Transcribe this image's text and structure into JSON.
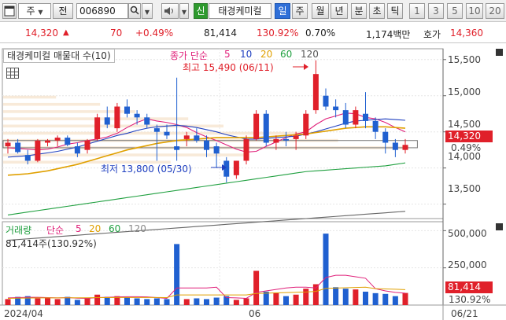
{
  "toolbar": {
    "code_label": "주",
    "prev_label": "전",
    "stock_code": "006890",
    "new_badge": "신",
    "stock_name": "태경케미컬",
    "periods": [
      "일",
      "주",
      "월",
      "년",
      "분",
      "초",
      "틱"
    ],
    "active_period": "일",
    "intervals": [
      "1",
      "3",
      "5",
      "10",
      "20"
    ]
  },
  "quote": {
    "price": "14,320",
    "change": "70",
    "change_pct": "+0.49%",
    "volume": "81,414",
    "volume_ratio": "130.92%",
    "turnover": "0.70%",
    "amount": "1,174백만",
    "ask_label": "호가",
    "ask_price": "14,360"
  },
  "legend": {
    "title": "태경케미컬 매물대 수(10)",
    "ma_label": "종가 단순",
    "ma_periods": [
      "5",
      "10",
      "20",
      "60",
      "120"
    ],
    "ma_colors": [
      "#e0207a",
      "#2040c0",
      "#e0a000",
      "#20a040",
      "#555555"
    ]
  },
  "annotations": {
    "high": "최고 15,490 (06/11)",
    "low": "최저 13,800 (05/30)"
  },
  "price_axis": [
    "15,500",
    "15,000",
    "14,500",
    "14,000",
    "13,500"
  ],
  "price_tag": {
    "value": "14,320",
    "pct": "0.49%"
  },
  "volume_legend": {
    "title": "거래량",
    "ma_label": "단순",
    "ma_periods": [
      "5",
      "20",
      "60",
      "120"
    ],
    "summary": "81,414주(130.92%)"
  },
  "volume_axis": [
    "500,000",
    "250,000"
  ],
  "volume_tag": {
    "value": "81,414",
    "pct": "130.92%"
  },
  "time_axis": {
    "start": "2024/04",
    "mid": "06",
    "end": "06/21"
  },
  "colors": {
    "up": "#e0202a",
    "down": "#2060d0",
    "accent": "#2f6fd8"
  },
  "chart_data": [
    {
      "type": "candlestick",
      "title": "태경케미컬 매물대 수(10)",
      "ylim": [
        13300,
        15650
      ],
      "y_ticks": [
        13500,
        14000,
        14500,
        15000,
        15500
      ],
      "candles": [
        {
          "o": 14300,
          "h": 14400,
          "l": 14200,
          "c": 14350
        },
        {
          "o": 14350,
          "h": 14400,
          "l": 14200,
          "c": 14220
        },
        {
          "o": 14180,
          "h": 14250,
          "l": 14050,
          "c": 14100
        },
        {
          "o": 14100,
          "h": 14400,
          "l": 14080,
          "c": 14380
        },
        {
          "o": 14350,
          "h": 14400,
          "l": 14300,
          "c": 14380
        },
        {
          "o": 14380,
          "h": 14450,
          "l": 14300,
          "c": 14420
        },
        {
          "o": 14420,
          "h": 14450,
          "l": 14300,
          "c": 14320
        },
        {
          "o": 14300,
          "h": 14350,
          "l": 14150,
          "c": 14200
        },
        {
          "o": 14250,
          "h": 14400,
          "l": 14200,
          "c": 14380
        },
        {
          "o": 14400,
          "h": 14750,
          "l": 14380,
          "c": 14700
        },
        {
          "o": 14700,
          "h": 14850,
          "l": 14550,
          "c": 14600
        },
        {
          "o": 14550,
          "h": 14900,
          "l": 14500,
          "c": 14850
        },
        {
          "o": 14850,
          "h": 14950,
          "l": 14700,
          "c": 14750
        },
        {
          "o": 14750,
          "h": 14800,
          "l": 14600,
          "c": 14700
        },
        {
          "o": 14700,
          "h": 14750,
          "l": 14550,
          "c": 14600
        },
        {
          "o": 14550,
          "h": 14600,
          "l": 14100,
          "c": 14500
        },
        {
          "o": 14500,
          "h": 14600,
          "l": 14400,
          "c": 14450
        },
        {
          "o": 14300,
          "h": 15250,
          "l": 14100,
          "c": 14250
        },
        {
          "o": 14400,
          "h": 14500,
          "l": 14300,
          "c": 14450
        },
        {
          "o": 14450,
          "h": 14550,
          "l": 14350,
          "c": 14380
        },
        {
          "o": 14380,
          "h": 14450,
          "l": 14150,
          "c": 14250
        },
        {
          "o": 14300,
          "h": 14350,
          "l": 14000,
          "c": 14200
        },
        {
          "o": 14100,
          "h": 14150,
          "l": 13800,
          "c": 13880
        },
        {
          "o": 13900,
          "h": 14100,
          "l": 13850,
          "c": 14100
        },
        {
          "o": 14100,
          "h": 14450,
          "l": 14050,
          "c": 14400
        },
        {
          "o": 14400,
          "h": 14800,
          "l": 14380,
          "c": 14750
        },
        {
          "o": 14750,
          "h": 14800,
          "l": 14300,
          "c": 14350
        },
        {
          "o": 14350,
          "h": 14450,
          "l": 14250,
          "c": 14400
        },
        {
          "o": 14400,
          "h": 14500,
          "l": 14300,
          "c": 14380
        },
        {
          "o": 14400,
          "h": 14500,
          "l": 14250,
          "c": 14450
        },
        {
          "o": 14450,
          "h": 14800,
          "l": 14400,
          "c": 14750
        },
        {
          "o": 14800,
          "h": 15490,
          "l": 14750,
          "c": 15300
        },
        {
          "o": 15000,
          "h": 15100,
          "l": 14800,
          "c": 14850
        },
        {
          "o": 14850,
          "h": 14950,
          "l": 14700,
          "c": 14800
        },
        {
          "o": 14800,
          "h": 14900,
          "l": 14550,
          "c": 14600
        },
        {
          "o": 14600,
          "h": 14850,
          "l": 14550,
          "c": 14800
        },
        {
          "o": 14750,
          "h": 15050,
          "l": 14550,
          "c": 14650
        },
        {
          "o": 14650,
          "h": 14700,
          "l": 14400,
          "c": 14500
        },
        {
          "o": 14500,
          "h": 14550,
          "l": 14200,
          "c": 14350
        },
        {
          "o": 14350,
          "h": 14400,
          "l": 14150,
          "c": 14250
        },
        {
          "o": 14250,
          "h": 14400,
          "l": 14200,
          "c": 14320
        }
      ],
      "ma": {
        "5": [
          14280,
          14270,
          14260,
          14250,
          14260,
          14290,
          14330,
          14350,
          14380,
          14400,
          14430,
          14480,
          14560,
          14630,
          14680,
          14650,
          14630,
          14600,
          14560,
          14490,
          14430,
          14380,
          14320,
          14260,
          14220,
          14230,
          14300,
          14360,
          14420,
          14470,
          14500,
          14600,
          14680,
          14720,
          14760,
          14750,
          14700,
          14680,
          14630,
          14560,
          14500
        ],
        "10": [
          14150,
          14160,
          14170,
          14190,
          14210,
          14230,
          14260,
          14290,
          14330,
          14370,
          14410,
          14450,
          14480,
          14520,
          14550,
          14570,
          14580,
          14590,
          14580,
          14560,
          14530,
          14500,
          14460,
          14430,
          14400,
          14400,
          14410,
          14420,
          14430,
          14440,
          14470,
          14500,
          14540,
          14580,
          14620,
          14650,
          14660,
          14670,
          14680,
          14670,
          14660
        ],
        "20": [
          13900,
          13910,
          13920,
          13940,
          13960,
          13990,
          14020,
          14050,
          14090,
          14130,
          14170,
          14210,
          14250,
          14280,
          14310,
          14340,
          14360,
          14380,
          14390,
          14400,
          14410,
          14420,
          14420,
          14420,
          14420,
          14420,
          14430,
          14440,
          14450,
          14460,
          14470,
          14490,
          14510,
          14530,
          14550,
          14560,
          14570,
          14570,
          14570,
          14560,
          14550
        ],
        "60": [
          13350,
          13370,
          13390,
          13410,
          13430,
          13450,
          13470,
          13490,
          13510,
          13530,
          13550,
          13570,
          13590,
          13610,
          13630,
          13650,
          13670,
          13690,
          13710,
          13730,
          13750,
          13770,
          13790,
          13810,
          13830,
          13850,
          13870,
          13890,
          13910,
          13930,
          13950,
          13960,
          13970,
          13980,
          13990,
          14000,
          14010,
          14020,
          14030,
          14050,
          14070
        ],
        "120": [
          13000,
          13010,
          13020,
          13030,
          13040,
          13050,
          13060,
          13070,
          13080,
          13090,
          13100,
          13110,
          13120,
          13130,
          13140,
          13150,
          13160,
          13170,
          13180,
          13190,
          13200,
          13210,
          13220,
          13230,
          13240,
          13250,
          13260,
          13270,
          13280,
          13290,
          13300,
          13310,
          13320,
          13330,
          13340,
          13350,
          13360,
          13370,
          13380,
          13390,
          13400
        ]
      }
    },
    {
      "type": "bar",
      "title": "거래량",
      "ylim": [
        0,
        560000
      ],
      "y_ticks": [
        250000,
        500000
      ],
      "values": [
        40000,
        55000,
        60000,
        45000,
        50000,
        40000,
        55000,
        35000,
        45000,
        70000,
        55000,
        60000,
        50000,
        45000,
        40000,
        45000,
        40000,
        410000,
        40000,
        45000,
        40000,
        50000,
        60000,
        35000,
        45000,
        230000,
        90000,
        80000,
        60000,
        70000,
        110000,
        140000,
        480000,
        120000,
        110000,
        105000,
        90000,
        80000,
        75000,
        60000,
        81414
      ],
      "ma5": [
        48000,
        50000,
        52000,
        52000,
        50000,
        48000,
        50000,
        46000,
        45000,
        50000,
        52000,
        55000,
        56000,
        56000,
        55000,
        50000,
        45000,
        115000,
        115000,
        115000,
        115000,
        120000,
        50000,
        48000,
        45000,
        85000,
        95000,
        105000,
        115000,
        120000,
        120000,
        115000,
        185000,
        200000,
        200000,
        190000,
        180000,
        110000,
        95000,
        85000,
        80000
      ],
      "ma20": [
        45000,
        46000,
        47000,
        48000,
        48000,
        48000,
        49000,
        49000,
        49000,
        50000,
        50000,
        51000,
        51000,
        51000,
        51000,
        51000,
        50000,
        68000,
        68000,
        68000,
        68000,
        68000,
        68000,
        68000,
        68000,
        78000,
        80000,
        82000,
        84000,
        86000,
        88000,
        92000,
        112000,
        114000,
        116000,
        118000,
        120000,
        110000,
        108000,
        106000,
        104000
      ]
    }
  ]
}
